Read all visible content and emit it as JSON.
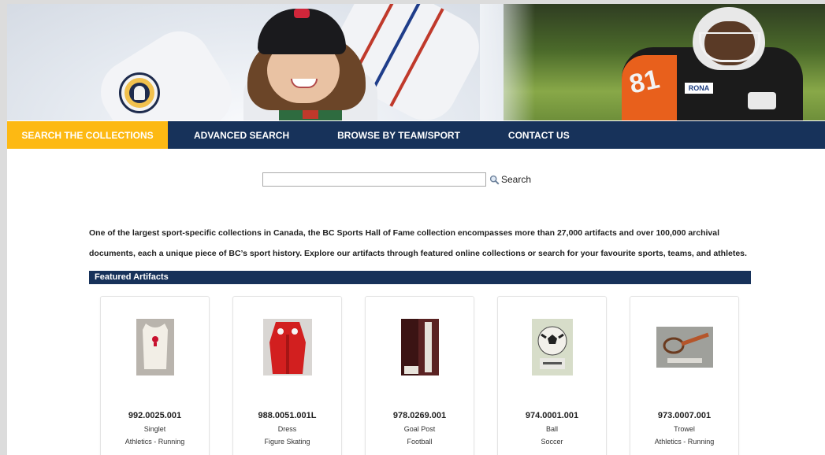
{
  "nav": {
    "items": [
      {
        "label": "SEARCH THE COLLECTIONS",
        "active": true
      },
      {
        "label": "ADVANCED SEARCH",
        "active": false
      },
      {
        "label": "BROWSE BY TEAM/SPORT",
        "active": false
      },
      {
        "label": "CONTACT US",
        "active": false
      }
    ]
  },
  "search": {
    "value": "",
    "button_label": "Search",
    "icon": "magnifier-icon"
  },
  "intro": {
    "text": "One of the largest sport-specific collections in Canada, the BC Sports Hall of Fame collection encompasses more than 27,000 artifacts and over 100,000 archival documents, each a unique piece of BC’s sport history. Explore our artifacts through featured online collections or search for your favourite sports, teams, and athletes."
  },
  "featured": {
    "title": "Featured Artifacts",
    "items": [
      {
        "accession": "992.0025.001",
        "name": "Singlet",
        "category": "Athletics - Running"
      },
      {
        "accession": "988.0051.001L",
        "name": "Dress",
        "category": "Figure Skating"
      },
      {
        "accession": "978.0269.001",
        "name": "Goal Post",
        "category": "Football"
      },
      {
        "accession": "974.0001.001",
        "name": "Ball",
        "category": "Soccer"
      },
      {
        "accession": "973.0007.001",
        "name": "Trowel",
        "category": "Athletics - Running"
      }
    ]
  },
  "colors": {
    "nav_bg": "#17325a",
    "nav_active": "#fdb913",
    "text": "#1f1f1f"
  }
}
